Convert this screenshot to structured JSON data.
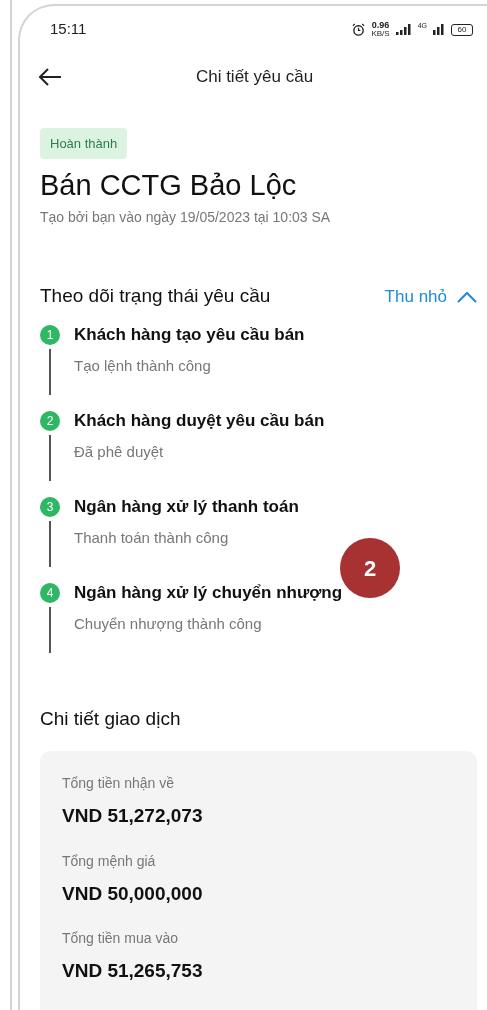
{
  "status_bar": {
    "time": "15:11",
    "speed_value": "0.96",
    "speed_unit": "KB/S",
    "network": "4G",
    "battery": "60"
  },
  "header": {
    "title": "Chi tiết yêu cầu"
  },
  "status_tag": "Hoàn thành",
  "title": "Bán CCTG Bảo Lộc",
  "created": "Tạo bởi bạn vào ngày 19/05/2023 tại 10:03 SA",
  "tracking": {
    "title": "Theo dõi trạng thái yêu cầu",
    "toggle": "Thu nhỏ",
    "expanded": true,
    "steps": [
      {
        "number": "1",
        "title": "Khách hàng tạo yêu cầu bán",
        "subtitle": "Tạo lệnh thành công"
      },
      {
        "number": "2",
        "title": "Khách hàng duyệt yêu cầu bán",
        "subtitle": "Đã phê duyệt"
      },
      {
        "number": "3",
        "title": "Ngân hàng xử lý thanh toán",
        "subtitle": "Thanh toán thành công"
      },
      {
        "number": "4",
        "title": "Ngân hàng xử lý chuyển nhượng",
        "subtitle": "Chuyển nhượng thành công"
      }
    ]
  },
  "annotation": "2",
  "details": {
    "title": "Chi tiết giao dịch",
    "items": [
      {
        "label": "Tổng tiền nhận về",
        "value": "VND 51,272,073"
      },
      {
        "label": "Tổng mệnh giá",
        "value": "VND 50,000,000"
      },
      {
        "label": "Tổng tiền mua vào",
        "value": "VND 51,265,753"
      }
    ]
  }
}
